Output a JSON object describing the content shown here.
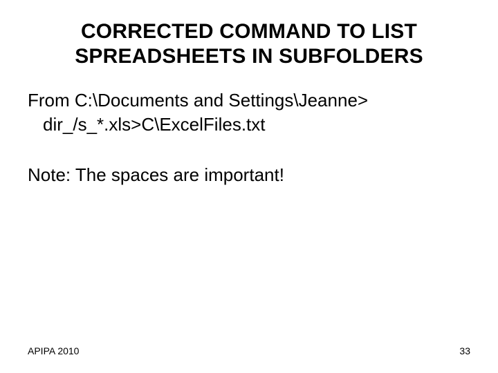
{
  "title": "CORRECTED COMMAND TO LIST SPREADSHEETS IN SUBFOLDERS",
  "body": {
    "line1": "From C:\\Documents and Settings\\Jeanne>",
    "line2": "dir_/s_*.xls>C\\ExcelFiles.txt"
  },
  "note": "Note: The spaces are important!",
  "footer": {
    "left": "APIPA 2010",
    "pageNumber": "33"
  }
}
